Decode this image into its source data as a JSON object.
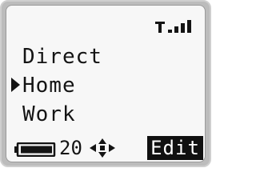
{
  "status": {
    "signal_icon": "signal-strength-icon"
  },
  "menu": {
    "items": [
      {
        "label": "Direct"
      },
      {
        "label": "Home"
      },
      {
        "label": "Work"
      }
    ],
    "selected_index": 1
  },
  "footer": {
    "battery_icon": "battery-icon",
    "battery_value": "20",
    "nav_icon": "four-way-navigation-icon",
    "softkey_label": "Edit"
  }
}
